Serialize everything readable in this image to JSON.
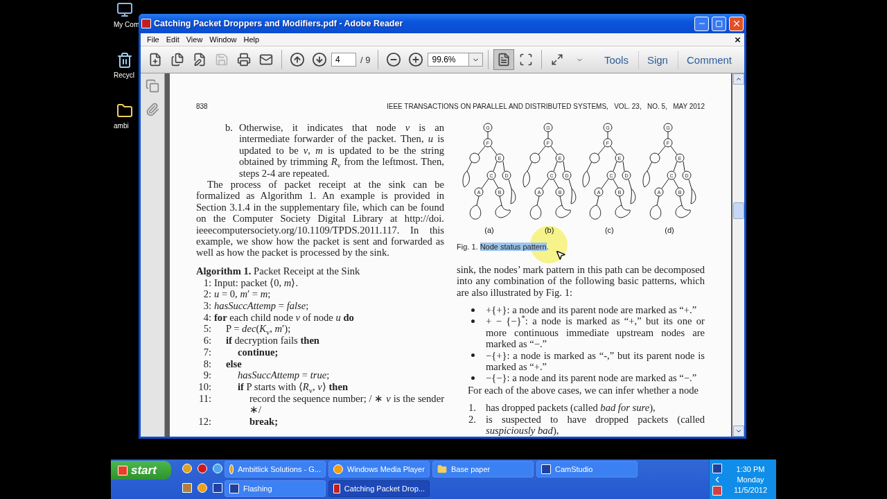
{
  "desktop_icons": [
    {
      "kind": "computer",
      "label": "My Com"
    },
    {
      "kind": "recycle",
      "label": "Recycl"
    },
    {
      "kind": "folder",
      "label": "ambi"
    }
  ],
  "window": {
    "title": "Catching Packet Droppers and Modifiers.pdf - Adobe Reader"
  },
  "menu": [
    "File",
    "Edit",
    "View",
    "Window",
    "Help"
  ],
  "toolbar": {
    "file_tools": [
      {
        "kind": "create",
        "disabled": false
      },
      {
        "kind": "combine",
        "disabled": false
      },
      {
        "kind": "edit",
        "disabled": false
      },
      {
        "kind": "save",
        "disabled": true
      },
      {
        "kind": "print",
        "disabled": false
      },
      {
        "kind": "email",
        "disabled": false
      }
    ],
    "page_field": "4",
    "page_total": "/ 9",
    "zoom_field": "99.6%",
    "view_modes": [
      {
        "kind": "fit-page",
        "selected": true
      },
      {
        "kind": "fit-width",
        "selected": false
      }
    ],
    "panes": [
      "Tools",
      "Sign",
      "Comment"
    ]
  },
  "document": {
    "page_number": "838",
    "running_head": "IEEE TRANSACTIONS ON PARALLEL AND DISTRIBUTED SYSTEMS,   VOL. 23,   NO. 5,   MAY 2012",
    "left_column": [
      {
        "kind": "step",
        "label": "b.",
        "text": "Otherwise, it indicates that node *v* is an intermediate forwarder of the packet. Then, *u* is updated to be *v*, *m* is updated to be the string obtained by trimming *R*$_{v}$ from the leftmost. Then, steps 2-4 are repeated."
      },
      {
        "kind": "paragraph",
        "text": "The process of packet receipt at the sink can be formalized as Algorithm 1. An example is provided in Section 3.1.4 in the supplementary file, which can be found on the Computer Society Digital Library at http://doi. ieeecomputersociety.org/10.1109/TPDS.2011.117. In this example, we show how the packet is sent and forwarded as well as how the packet is processed by the sink."
      },
      {
        "kind": "algorithm",
        "label": "Algorithm 1.",
        "title": "Packet Receipt at the Sink",
        "lines": [
          {
            "number": "1:",
            "text": "Input: packet ⟨0, *m*⟩.",
            "bold": false
          },
          {
            "number": "2:",
            "text": "*u* = 0, *m*′ = *m*;",
            "bold": false
          },
          {
            "number": "3:",
            "text": "*hasSuccAttemp* = *false*;",
            "bold": false
          },
          {
            "number": "4:",
            "text": "**for** each child node *v* of node *u* **do**",
            "bold": false,
            "children": [
              {
                "number": "5:",
                "text": "P = *dec*(*K*$_{v}$, *m*′);",
                "bold": false
              },
              {
                "number": "6:",
                "text": "**if** decryption fails **then**",
                "bold": false,
                "children": [
                  {
                    "number": "7:",
                    "text": "continue;",
                    "bold": true
                  }
                ]
              },
              {
                "number": "8:",
                "text": "else",
                "bold": true,
                "children": [
                  {
                    "number": "9:",
                    "text": "*hasSuccAttemp* = *true*;",
                    "bold": false
                  },
                  {
                    "number": "10:",
                    "text": "**if** P starts with ⟨*R*$_{v}$, *v*⟩ **then**",
                    "bold": false,
                    "children": [
                      {
                        "number": "11:",
                        "text": "record the sequence number; / ∗ *v* is the sender ∗/",
                        "bold": false
                      },
                      {
                        "number": "12:",
                        "text": "break;",
                        "bold": true
                      }
                    ]
                  }
                ]
              }
            ]
          }
        ]
      }
    ],
    "right_column": [
      {
        "kind": "figure",
        "panels": [
          {
            "label": "(a)",
            "nodes": [
              "G",
              "F",
              "E",
              "C",
              "D",
              "A",
              "B"
            ]
          },
          {
            "label": "(b)",
            "nodes": [
              "G",
              "F",
              "E",
              "C",
              "D",
              "A",
              "B"
            ]
          },
          {
            "label": "(c)",
            "nodes": [
              "G",
              "F",
              "E",
              "C",
              "D",
              "A",
              "B"
            ]
          },
          {
            "label": "(d)",
            "nodes": [
              "G",
              "F",
              "E",
              "C",
              "D",
              "A",
              "B"
            ]
          }
        ],
        "caption_label": "Fig. 1.",
        "caption_selected": "Node status pattern",
        "caption_end": "."
      },
      {
        "kind": "paragraph_plain",
        "text": "sink, the nodes’ mark pattern in this path can be decomposed into any combination of the following basic patterns, which are also illustrated by Fig. 1:"
      },
      {
        "kind": "bullets",
        "items": [
          "+{+}: a node and its parent node are marked as “+.”",
          "+ − {−}$^{*}$: a node is marked as “+,” but its one or more continuous immediate upstream nodes are marked as “−.”",
          "−{+}: a node is marked as “-,” but its parent node is marked as “+.”",
          "−{−}: a node and its parent node are marked as “−.”"
        ]
      },
      {
        "kind": "paragraph",
        "text": "For each of the above cases, we can infer whether a node"
      },
      {
        "kind": "numbered",
        "items": [
          {
            "label": "1.",
            "text": "has dropped packets (called *bad for sure*),"
          },
          {
            "label": "2.",
            "text": "is suspected to have dropped packets (called *suspiciously bad*),"
          }
        ]
      }
    ]
  },
  "taskbar": {
    "start": "start",
    "task_rows": [
      [
        {
          "kind": "browser",
          "label": "Ambitlick Solutions - G...",
          "selected": false
        },
        {
          "kind": "media",
          "label": "Windows Media Player",
          "selected": false
        },
        {
          "kind": "folder",
          "label": "Base paper",
          "selected": false
        },
        {
          "kind": "recorder",
          "label": "CamStudio",
          "selected": false
        }
      ],
      [
        {
          "kind": "recorder",
          "label": "Flashing",
          "selected": false
        },
        {
          "kind": "pdf",
          "label": "Catching Packet Drop...",
          "selected": true
        }
      ]
    ],
    "time": "1:30 PM",
    "day": "Monday",
    "date": "11/5/2012"
  }
}
